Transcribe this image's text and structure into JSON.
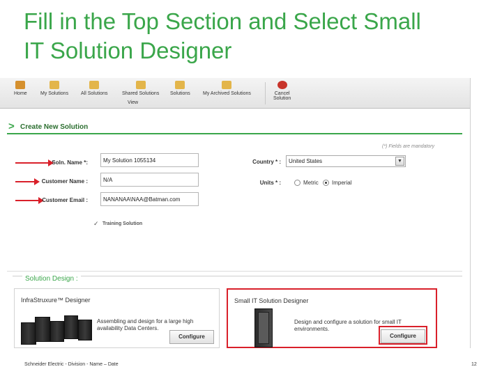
{
  "slide": {
    "title_line1": "Fill in the Top Section and Select Small",
    "title_line2": "IT Solution Designer",
    "footer_left": "Schneider Electric - Division - Name – Date",
    "page_number": "12"
  },
  "toolbar": {
    "items": [
      {
        "label": "Home",
        "icon": "home-icon"
      },
      {
        "label": "My Solutions",
        "icon": "folder-icon"
      },
      {
        "label": "All Solutions",
        "icon": "folder-icon"
      },
      {
        "label": "Shared Solutions",
        "icon": "shared-folder-icon"
      },
      {
        "label": "Solutions",
        "icon": "folder-icon"
      },
      {
        "label": "My Archived Solutions",
        "icon": "archive-folder-icon"
      },
      {
        "label": "Cancel",
        "label2": "Solution",
        "icon": "cancel-icon"
      }
    ],
    "view_caption": "View"
  },
  "create": {
    "heading": "Create New Solution",
    "mandatory_note": "(*) Fields are mandatory",
    "solution_name_label": "Soln. Name *:",
    "solution_name_value": "My Solution 1055134",
    "customer_name_label": "Customer Name :",
    "customer_name_value": "N/A",
    "customer_email_label": "Customer Email :",
    "customer_email_value": "NANANAA\\NAA@Batman.com",
    "country_label": "Country * :",
    "country_value": "United States",
    "units_label": "Units * :",
    "units_options": [
      "Metric",
      "Imperial"
    ],
    "units_selected": "Imperial",
    "training_label": "Training Solution"
  },
  "design": {
    "heading": "Solution Design :",
    "cards": [
      {
        "title": "InfraStruxure™ Designer",
        "description": "Assembling and design for a large high availability Data Centers.",
        "button": "Configure"
      },
      {
        "title": "Small IT Solution Designer",
        "description": "Design and configure a solution for small IT environments.",
        "button": "Configure"
      }
    ]
  },
  "colors": {
    "title_green": "#3aa64a",
    "highlight_red": "#d9202a",
    "section_green": "#2b6e2f"
  }
}
